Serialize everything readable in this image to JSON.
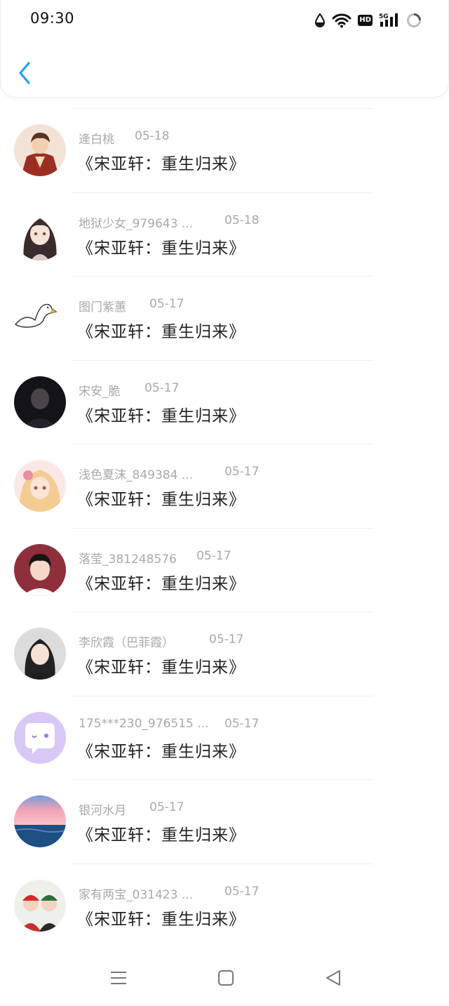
{
  "status": {
    "time": "09:30",
    "hd_label": "HD",
    "signal_label": "5G"
  },
  "icons": {
    "back": "chevron-left-icon",
    "menu": "menu-icon",
    "home": "home-square-icon",
    "nav_back": "triangle-back-icon"
  },
  "colors": {
    "accent": "#2aa0e6",
    "meta": "#a9a9a9",
    "title": "#222222"
  },
  "comments": [
    {
      "user": "逄白桃",
      "date": "05-18",
      "title": "《宋亚轩：重生归来》"
    },
    {
      "user": "地狱少女_979643 ...",
      "date": "05-18",
      "title": "《宋亚轩：重生归来》"
    },
    {
      "user": "图门紫蕙",
      "date": "05-17",
      "title": "《宋亚轩：重生归来》"
    },
    {
      "user": "宋安_脆",
      "date": "05-17",
      "title": "《宋亚轩：重生归来》"
    },
    {
      "user": "浅色夏沫_849384 ...",
      "date": "05-17",
      "title": "《宋亚轩：重生归来》"
    },
    {
      "user": "落莹_381248576",
      "date": "05-17",
      "title": "《宋亚轩：重生归来》"
    },
    {
      "user": "李欣霞（巴菲霞）",
      "date": "05-17",
      "title": "《宋亚轩：重生归来》"
    },
    {
      "user": "175***230_976515 ...",
      "date": "05-17",
      "title": "《宋亚轩：重生归来》"
    },
    {
      "user": "银河水月",
      "date": "05-17",
      "title": "《宋亚轩：重生归来》"
    },
    {
      "user": "家有两宝_031423 ...",
      "date": "05-17",
      "title": "《宋亚轩：重生归来》"
    }
  ]
}
